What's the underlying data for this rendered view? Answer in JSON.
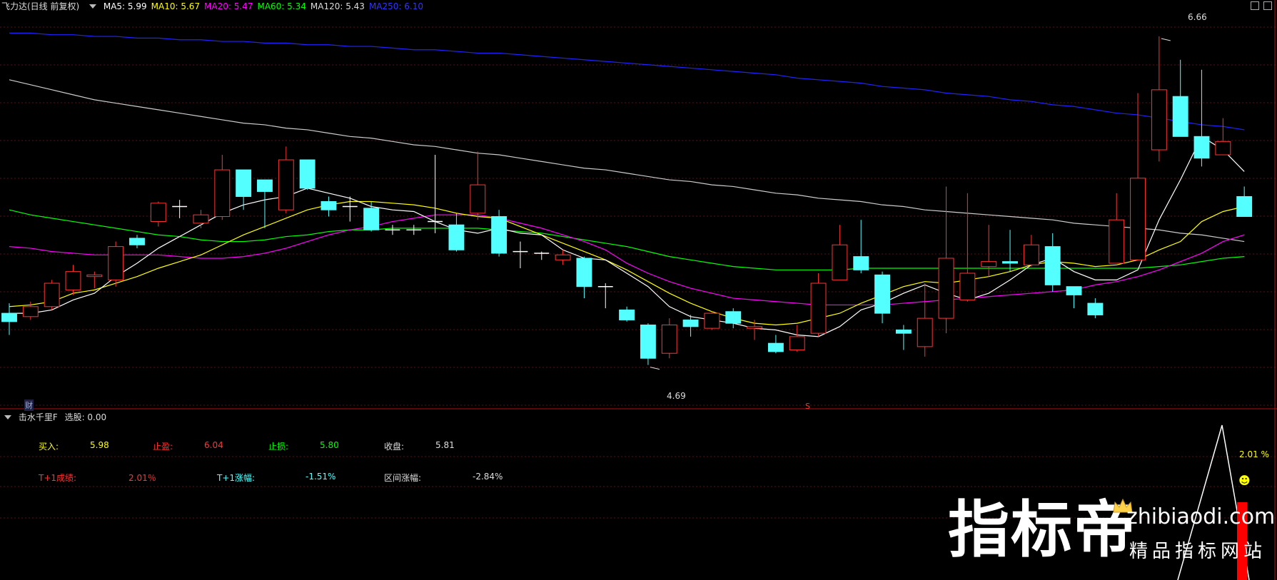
{
  "header": {
    "title": "飞力达(日线 前复权)",
    "ma": [
      {
        "label": "MA5: 5.99",
        "color": "#ffffff"
      },
      {
        "label": "MA10: 5.67",
        "color": "#ffff00"
      },
      {
        "label": "MA20: 5.47",
        "color": "#ff00ff"
      },
      {
        "label": "MA60: 5.34",
        "color": "#00ff00"
      },
      {
        "label": "MA120: 5.43",
        "color": "#dddddd"
      },
      {
        "label": "MA250: 6.10",
        "color": "#3333ff"
      }
    ]
  },
  "marks": {
    "high_label": "6.66",
    "low_label": "4.69",
    "cai_label": "财",
    "s_label": "S"
  },
  "indicator": {
    "title": "击水千里F",
    "select_label": "选股: 0.00",
    "buy_label": "买入:",
    "buy_value": "5.98",
    "tp_label": "止盈:",
    "tp_value": "6.04",
    "sl_label": "止损:",
    "sl_value": "5.80",
    "close_label": "收盘:",
    "close_value": "5.81",
    "t1_result_label": "T+1成绩:",
    "t1_result_value": "2.01％",
    "t1_change_label": "T+1涨幅:",
    "t1_change_value": "-1.51%",
    "range_label": "区间涨幅:",
    "range_value": "-2.84%",
    "right_value": "2.01 %"
  },
  "watermark": {
    "big": "指标帝",
    "site": "zhibiaodi.com",
    "sub": "精品指标网站"
  },
  "colors": {
    "up": "#ff3333",
    "down": "#54ffff",
    "ma5": "#ffffff",
    "ma10": "#ffff00",
    "ma20": "#ff00ff",
    "ma60": "#00ff00",
    "ma120": "#cccccc",
    "ma250": "#2222ff"
  },
  "chart_data": {
    "type": "candlestick",
    "title": "飞力达(日线 前复权)",
    "ylim": [
      4.5,
      6.75
    ],
    "candles": [
      [
        5.0,
        4.95,
        5.06,
        4.87
      ],
      [
        4.98,
        5.04,
        5.07,
        4.96
      ],
      [
        5.04,
        5.18,
        5.2,
        5.02
      ],
      [
        5.14,
        5.25,
        5.29,
        5.11
      ],
      [
        5.22,
        5.23,
        5.25,
        5.15
      ],
      [
        5.2,
        5.4,
        5.43,
        5.16
      ],
      [
        5.45,
        5.41,
        5.47,
        5.39
      ],
      [
        5.55,
        5.66,
        5.67,
        5.52
      ],
      [
        5.64,
        5.64,
        5.68,
        5.57
      ],
      [
        5.54,
        5.59,
        5.62,
        5.51
      ],
      [
        5.58,
        5.86,
        5.95,
        5.56
      ],
      [
        5.86,
        5.7,
        5.86,
        5.62
      ],
      [
        5.8,
        5.73,
        5.78,
        5.51
      ],
      [
        5.62,
        5.92,
        6.0,
        5.6
      ],
      [
        5.92,
        5.75,
        5.92,
        5.74
      ],
      [
        5.67,
        5.62,
        5.7,
        5.58
      ],
      [
        5.64,
        5.64,
        5.7,
        5.55
      ],
      [
        5.63,
        5.5,
        5.67,
        5.49
      ],
      [
        5.5,
        5.5,
        5.53,
        5.47
      ],
      [
        5.5,
        5.5,
        5.53,
        5.47
      ],
      [
        5.55,
        5.55,
        5.95,
        5.48
      ],
      [
        5.53,
        5.38,
        5.6,
        5.37
      ],
      [
        5.6,
        5.77,
        5.97,
        5.56
      ],
      [
        5.58,
        5.36,
        5.62,
        5.34
      ],
      [
        5.37,
        5.37,
        5.43,
        5.27
      ],
      [
        5.36,
        5.36,
        5.37,
        5.32
      ],
      [
        5.32,
        5.35,
        5.38,
        5.29
      ],
      [
        5.33,
        5.16,
        5.34,
        5.09
      ],
      [
        5.16,
        5.16,
        5.18,
        5.03
      ],
      [
        5.02,
        4.96,
        5.04,
        4.95
      ],
      [
        4.93,
        4.73,
        4.94,
        4.69
      ],
      [
        4.76,
        4.93,
        4.97,
        4.73
      ],
      [
        4.96,
        4.92,
        4.99,
        4.86
      ],
      [
        4.91,
        5.0,
        5.01,
        4.9
      ],
      [
        5.01,
        4.94,
        5.03,
        4.91
      ],
      [
        4.91,
        4.92,
        4.96,
        4.84
      ],
      [
        4.82,
        4.77,
        4.87,
        4.76
      ],
      [
        4.78,
        4.86,
        4.93,
        4.77
      ],
      [
        4.88,
        5.18,
        5.24,
        4.86
      ],
      [
        5.2,
        5.41,
        5.53,
        5.21
      ],
      [
        5.34,
        5.26,
        5.56,
        5.24
      ],
      [
        5.23,
        5.0,
        5.25,
        4.94
      ],
      [
        4.9,
        4.88,
        4.93,
        4.78
      ],
      [
        4.8,
        4.97,
        5.18,
        4.74
      ],
      [
        4.97,
        5.33,
        5.76,
        4.88
      ],
      [
        5.08,
        5.24,
        5.72,
        5.07
      ],
      [
        5.28,
        5.31,
        5.53,
        5.22
      ],
      [
        5.31,
        5.3,
        5.5,
        5.25
      ],
      [
        5.29,
        5.41,
        5.47,
        5.28
      ],
      [
        5.4,
        5.17,
        5.48,
        5.13
      ],
      [
        5.16,
        5.11,
        5.14,
        5.03
      ],
      [
        5.06,
        4.99,
        5.09,
        4.97
      ],
      [
        5.3,
        5.56,
        5.72,
        5.31
      ],
      [
        5.32,
        5.81,
        6.32,
        5.34
      ],
      [
        5.98,
        6.34,
        6.66,
        5.91
      ],
      [
        6.3,
        6.06,
        6.52,
        6.06
      ],
      [
        6.06,
        5.93,
        6.46,
        5.88
      ],
      [
        5.95,
        6.03,
        6.17,
        5.98
      ],
      [
        5.7,
        5.58,
        5.76,
        5.58
      ]
    ],
    "ma5": [
      5.0,
      5.0,
      5.02,
      5.08,
      5.12,
      5.22,
      5.3,
      5.39,
      5.46,
      5.53,
      5.6,
      5.65,
      5.68,
      5.7,
      5.75,
      5.72,
      5.69,
      5.64,
      5.62,
      5.61,
      5.55,
      5.5,
      5.48,
      5.51,
      5.48,
      5.47,
      5.38,
      5.33,
      5.32,
      5.24,
      5.16,
      5.04,
      4.98,
      4.96,
      4.94,
      4.91,
      4.9,
      4.87,
      4.86,
      4.92,
      5.02,
      5.06,
      5.12,
      5.17,
      5.12,
      5.08,
      5.12,
      5.2,
      5.29,
      5.33,
      5.25,
      5.2,
      5.2,
      5.26,
      5.56,
      5.8,
      6.06,
      5.98,
      5.85
    ],
    "ma10": [
      5.04,
      5.05,
      5.07,
      5.12,
      5.14,
      5.18,
      5.22,
      5.27,
      5.31,
      5.35,
      5.41,
      5.47,
      5.52,
      5.57,
      5.62,
      5.65,
      5.67,
      5.67,
      5.66,
      5.65,
      5.63,
      5.6,
      5.58,
      5.57,
      5.52,
      5.47,
      5.42,
      5.37,
      5.32,
      5.26,
      5.19,
      5.12,
      5.06,
      5.01,
      4.97,
      4.94,
      4.93,
      4.94,
      4.97,
      5.0,
      5.06,
      5.11,
      5.16,
      5.19,
      5.18,
      5.2,
      5.22,
      5.25,
      5.29,
      5.31,
      5.3,
      5.28,
      5.29,
      5.32,
      5.38,
      5.43,
      5.55,
      5.61,
      5.64
    ],
    "ma20": [
      5.4,
      5.39,
      5.37,
      5.36,
      5.35,
      5.35,
      5.35,
      5.35,
      5.34,
      5.33,
      5.33,
      5.34,
      5.36,
      5.39,
      5.43,
      5.47,
      5.5,
      5.52,
      5.55,
      5.57,
      5.59,
      5.59,
      5.59,
      5.57,
      5.54,
      5.51,
      5.47,
      5.43,
      5.38,
      5.3,
      5.24,
      5.19,
      5.15,
      5.12,
      5.09,
      5.08,
      5.07,
      5.06,
      5.05,
      5.05,
      5.05,
      5.05,
      5.06,
      5.07,
      5.08,
      5.09,
      5.1,
      5.11,
      5.12,
      5.13,
      5.14,
      5.17,
      5.19,
      5.22,
      5.26,
      5.31,
      5.36,
      5.43,
      5.47
    ],
    "ma60": [
      5.62,
      5.59,
      5.57,
      5.55,
      5.53,
      5.51,
      5.49,
      5.47,
      5.46,
      5.44,
      5.43,
      5.43,
      5.44,
      5.46,
      5.47,
      5.49,
      5.5,
      5.5,
      5.51,
      5.51,
      5.51,
      5.51,
      5.51,
      5.5,
      5.49,
      5.48,
      5.46,
      5.44,
      5.42,
      5.4,
      5.37,
      5.34,
      5.32,
      5.3,
      5.28,
      5.27,
      5.26,
      5.26,
      5.26,
      5.26,
      5.27,
      5.27,
      5.27,
      5.27,
      5.27,
      5.27,
      5.27,
      5.27,
      5.27,
      5.27,
      5.27,
      5.27,
      5.27,
      5.27,
      5.28,
      5.29,
      5.31,
      5.33,
      5.34
    ],
    "ma120": [
      6.4,
      6.37,
      6.34,
      6.31,
      6.28,
      6.26,
      6.24,
      6.22,
      6.2,
      6.18,
      6.16,
      6.14,
      6.13,
      6.11,
      6.1,
      6.08,
      6.06,
      6.05,
      6.03,
      6.01,
      6.0,
      5.98,
      5.96,
      5.95,
      5.93,
      5.91,
      5.89,
      5.87,
      5.86,
      5.84,
      5.82,
      5.8,
      5.79,
      5.77,
      5.76,
      5.74,
      5.72,
      5.71,
      5.69,
      5.68,
      5.67,
      5.65,
      5.64,
      5.62,
      5.61,
      5.6,
      5.59,
      5.58,
      5.57,
      5.56,
      5.54,
      5.53,
      5.52,
      5.51,
      5.5,
      5.48,
      5.47,
      5.45,
      5.43
    ],
    "ma250": [
      6.68,
      6.68,
      6.67,
      6.67,
      6.66,
      6.66,
      6.65,
      6.65,
      6.64,
      6.64,
      6.63,
      6.63,
      6.62,
      6.62,
      6.61,
      6.61,
      6.6,
      6.6,
      6.59,
      6.58,
      6.58,
      6.57,
      6.56,
      6.56,
      6.55,
      6.54,
      6.53,
      6.52,
      6.51,
      6.5,
      6.49,
      6.48,
      6.47,
      6.46,
      6.45,
      6.44,
      6.43,
      6.41,
      6.4,
      6.39,
      6.38,
      6.36,
      6.35,
      6.34,
      6.32,
      6.31,
      6.3,
      6.28,
      6.27,
      6.25,
      6.24,
      6.22,
      6.2,
      6.19,
      6.17,
      6.15,
      6.13,
      6.12,
      6.1
    ],
    "indicator_peak": {
      "value": 2.01
    }
  }
}
